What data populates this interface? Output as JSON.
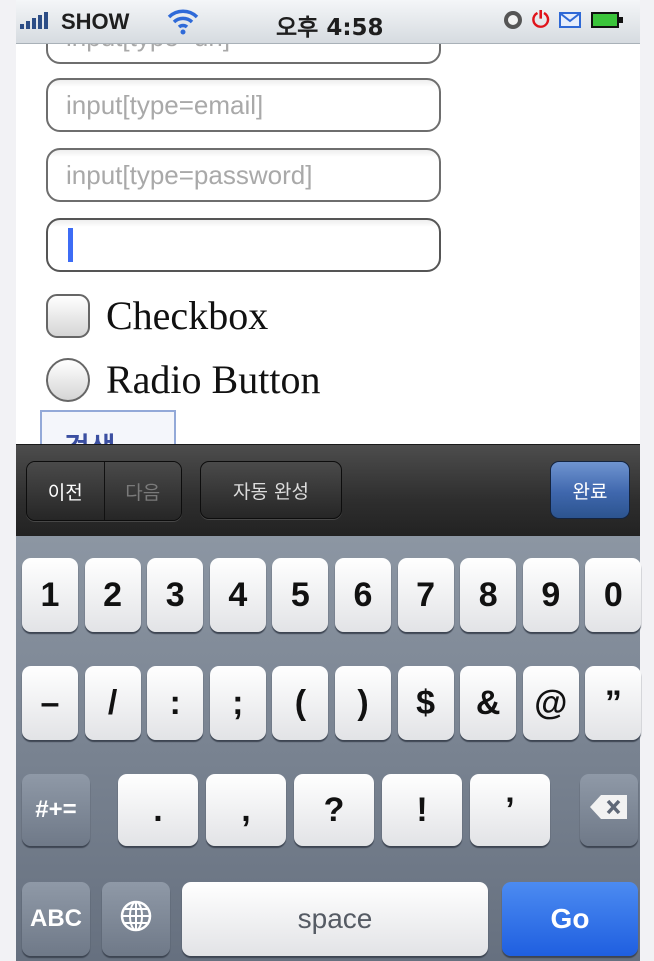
{
  "status_bar": {
    "carrier": "SHOW",
    "time": "오후 4:58",
    "icons": [
      "signal-icon",
      "wifi-icon",
      "alarm-icon",
      "power-icon",
      "mail-icon",
      "battery-icon"
    ]
  },
  "form": {
    "url_field_placeholder": "input[type=url]",
    "email_field_placeholder": "input[type=email]",
    "password_field_placeholder": "input[type=password]",
    "active_field_value": "",
    "checkbox_label": "Checkbox",
    "radio_label": "Radio Button",
    "search_button_label": "검색"
  },
  "form_assistant": {
    "previous_label": "이전",
    "next_label": "다음",
    "autofill_label": "자동 완성",
    "done_label": "완료"
  },
  "keyboard": {
    "row1": [
      "1",
      "2",
      "3",
      "4",
      "5",
      "6",
      "7",
      "8",
      "9",
      "0"
    ],
    "row2": [
      "–",
      "/",
      ":",
      ";",
      "(",
      ")",
      "$",
      "&",
      "@",
      "”"
    ],
    "row3_shift": "#+=",
    "row3": [
      ".",
      ",",
      "?",
      "!",
      "’"
    ],
    "abc_label": "ABC",
    "globe_icon": "globe-icon",
    "space_label": "space",
    "go_label": "Go",
    "delete_icon": "backspace-icon"
  },
  "colors": {
    "go_key": "#1f5fe0",
    "done_button": "#3f67ad",
    "cursor": "#3d6cf5"
  }
}
